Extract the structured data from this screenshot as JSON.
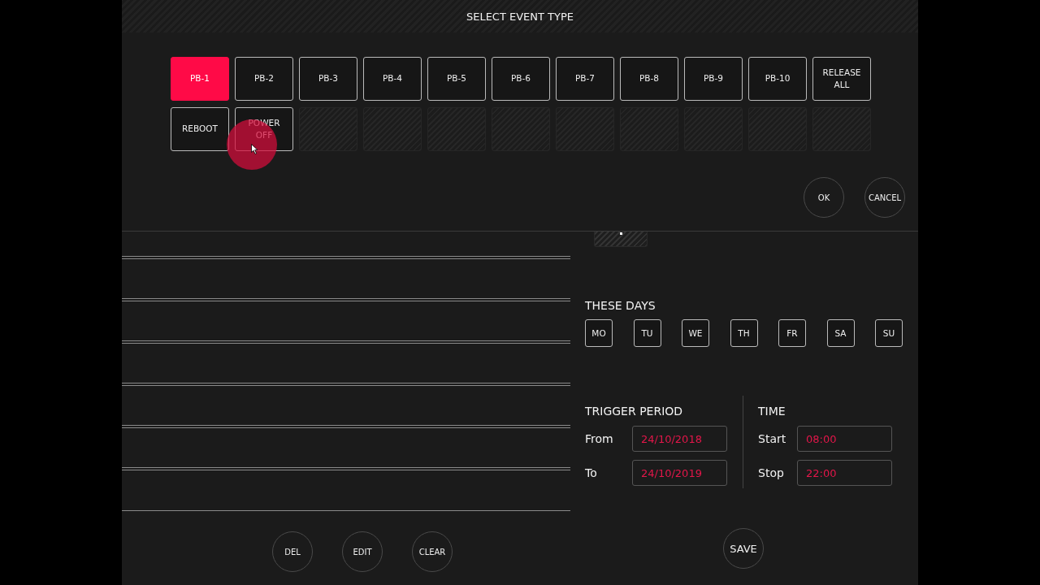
{
  "dialog": {
    "title": "SELECT EVENT TYPE",
    "event_types": [
      {
        "kind": "button",
        "label": "PB-1",
        "selected": true
      },
      {
        "kind": "button",
        "label": "PB-2",
        "selected": false
      },
      {
        "kind": "button",
        "label": "PB-3",
        "selected": false
      },
      {
        "kind": "button",
        "label": "PB-4",
        "selected": false
      },
      {
        "kind": "button",
        "label": "PB-5",
        "selected": false
      },
      {
        "kind": "button",
        "label": "PB-6",
        "selected": false
      },
      {
        "kind": "button",
        "label": "PB-7",
        "selected": false
      },
      {
        "kind": "button",
        "label": "PB-8",
        "selected": false
      },
      {
        "kind": "button",
        "label": "PB-9",
        "selected": false
      },
      {
        "kind": "button",
        "label": "PB-10",
        "selected": false
      },
      {
        "kind": "button",
        "label": "RELEASE ALL",
        "selected": false
      },
      {
        "kind": "button",
        "label": "REBOOT",
        "selected": false
      },
      {
        "kind": "button",
        "label": "POWER OFF",
        "selected": false
      },
      {
        "kind": "empty"
      },
      {
        "kind": "empty"
      },
      {
        "kind": "empty"
      },
      {
        "kind": "empty"
      },
      {
        "kind": "empty"
      },
      {
        "kind": "empty"
      },
      {
        "kind": "empty"
      },
      {
        "kind": "empty"
      },
      {
        "kind": "empty"
      }
    ],
    "actions": [
      "OK",
      "CANCEL"
    ]
  },
  "event_list": {
    "buttons": [
      "DEL",
      "EDIT",
      "CLEAR"
    ]
  },
  "schedule": {
    "days_title": "THESE DAYS",
    "days": [
      {
        "label": "MO",
        "selected": false
      },
      {
        "label": "TU",
        "selected": false
      },
      {
        "label": "WE",
        "selected": false
      },
      {
        "label": "TH",
        "selected": false
      },
      {
        "label": "FR",
        "selected": false
      },
      {
        "label": "SA",
        "selected": false
      },
      {
        "label": "SU",
        "selected": false
      }
    ],
    "period": {
      "title": "TRIGGER PERIOD",
      "fields": [
        {
          "label": "From",
          "value": "24/10/2018"
        },
        {
          "label": "To",
          "value": "24/10/2019"
        }
      ]
    },
    "time": {
      "title": "TIME",
      "fields": [
        {
          "label": "Start",
          "value": "08:00"
        },
        {
          "label": "Stop",
          "value": "22:00"
        }
      ]
    },
    "save": "SAVE"
  }
}
